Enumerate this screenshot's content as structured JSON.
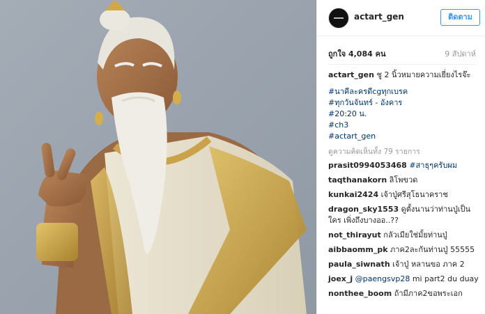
{
  "post": {
    "username": "actart_gen",
    "follow_label": "ติดตาม",
    "likes": "ถูกใจ 4,084 คน",
    "time": "9 สัปดาห์",
    "caption": {
      "user": "actart_gen",
      "text": "ชู 2 นิ้วหมายความเยี่ยงไรจ๊ะ",
      "hashtags": [
        "#นาคีละครดีcgทุกเบรค",
        "#ทุกวันจันทร์ - อังคาร",
        "#20:20 น.",
        "#ch3",
        "#actart_gen"
      ]
    },
    "view_all": "ดูความคิดเห็นทั้ง 79 รายการ"
  },
  "comments": [
    {
      "user": "prasit0994053468",
      "text": "",
      "mention": "#สาธุๆครับผม"
    },
    {
      "user": "taqthanakorn",
      "text": "ลิโพขวด",
      "mention": ""
    },
    {
      "user": "kunkai2424",
      "text": "เจ้าปู่ศรีสุโธนาคราช",
      "mention": ""
    },
    {
      "user": "dragon_sky1553",
      "text": "ดูตั้งนานว่าท่านปู่เป็นใคร เพิ่งถึงบางออ..??",
      "mention": ""
    },
    {
      "user": "not_thirayut",
      "text": "กลัวเมียใช่มั้ยท่านปู่",
      "mention": ""
    },
    {
      "user": "aibbaomm_pk",
      "text": "ภาค2ละกันท่านปู่ 55555",
      "mention": ""
    },
    {
      "user": "paula_siwnath",
      "text": "เจ้าปู่ หลานขอ ภาค 2",
      "mention": ""
    },
    {
      "user": "joex_j",
      "text": "mi part2 du duay",
      "mention": "@paengsvp28"
    },
    {
      "user": "nonthee_boom",
      "text": "ถ้ามีภาค2ขอพระเอก",
      "mention": ""
    }
  ],
  "colors": {
    "follow": "#3897f0",
    "link": "#003569",
    "photo_bg": "#9aa3ad"
  }
}
